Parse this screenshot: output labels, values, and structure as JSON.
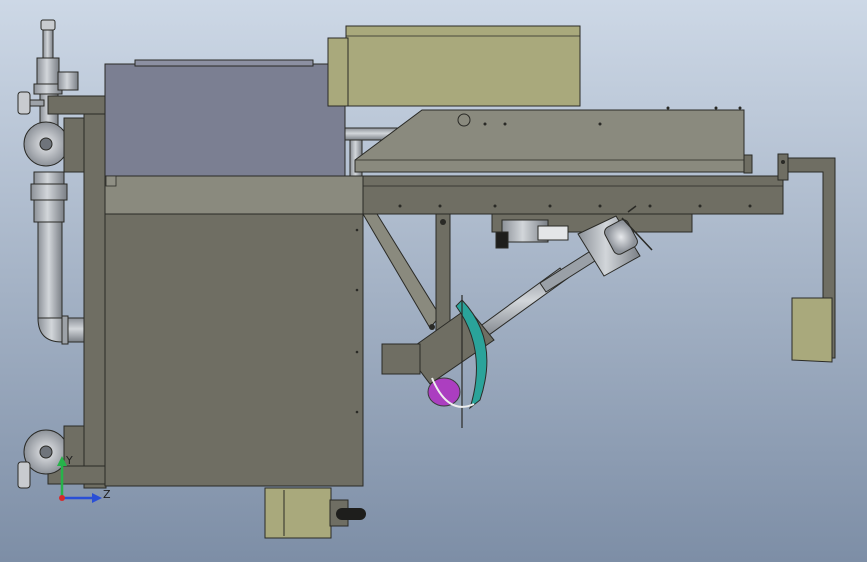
{
  "viewport": {
    "background_top": "#cdd8e6",
    "background_bottom": "#7d8ea6"
  },
  "colors": {
    "frame": "#6f6e63",
    "frame_dark": "#5b5a50",
    "frame_light": "#8a8a7e",
    "edge": "#2a2a26",
    "hopper": "#7b7f92",
    "hopper_light": "#8c90a2",
    "electrical_box": "#a9a97c",
    "pipe": "#a8adb3",
    "pipe_dark": "#7c8188",
    "valve_metal": "#c9ccd0",
    "accent_teal": "#2aa39a",
    "accent_magenta": "#b02dc2",
    "axis_y": "#27b34a",
    "axis_z": "#2a4fd6",
    "axis_origin": "#d62a2a"
  },
  "triad": {
    "y_label": "Y",
    "z_label": "Z"
  }
}
